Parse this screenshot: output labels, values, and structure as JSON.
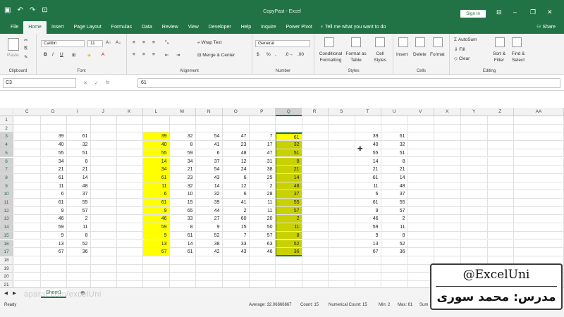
{
  "window": {
    "title": "CopyPast - Excel",
    "sign_in": "Sign in",
    "qat_icons": [
      "save-icon",
      "undo-icon",
      "redo-icon",
      "touch-mode-icon"
    ]
  },
  "tabs": [
    "File",
    "Home",
    "Insert",
    "Page Layout",
    "Formulas",
    "Data",
    "Review",
    "View",
    "Developer",
    "Help",
    "Inquire",
    "Power Pivot"
  ],
  "active_tab": "Home",
  "tell_me": "Tell me what you want to do",
  "share": "Share",
  "ribbon": {
    "clipboard": {
      "label": "Clipboard",
      "paste": "Paste"
    },
    "font": {
      "label": "Font",
      "name": "Calibri",
      "size": "11",
      "bold": "B",
      "italic": "I",
      "underline": "U"
    },
    "alignment": {
      "label": "Alignment",
      "wrap": "Wrap Text",
      "merge": "Merge & Center"
    },
    "number": {
      "label": "Number",
      "format": "General",
      "currency": "$",
      "percent": "%",
      "comma": ","
    },
    "styles": {
      "label": "Styles",
      "cond": "Conditional Formatting",
      "table": "Format as Table",
      "cell": "Cell Styles"
    },
    "cells": {
      "label": "Cells",
      "insert": "Insert",
      "delete": "Delete",
      "format": "Format"
    },
    "editing": {
      "label": "Editing",
      "autosum": "AutoSum",
      "fill": "Fill",
      "clear": "Clear",
      "sort": "Sort & Filter",
      "find": "Find & Select"
    }
  },
  "formula_bar": {
    "name_box": "C3",
    "content": "61",
    "fx": "fx"
  },
  "columns": [
    "C",
    "D",
    "I",
    "J",
    "K",
    "L",
    "M",
    "N",
    "O",
    "P",
    "Q",
    "R",
    "S",
    "T",
    "U",
    "V",
    "X",
    "Y",
    "Z",
    "AA"
  ],
  "selected_column": "Q",
  "row_numbers": [
    "1",
    "2",
    "3",
    "4",
    "5",
    "6",
    "7",
    "8",
    "9",
    "10",
    "11",
    "12",
    "13",
    "14",
    "15",
    "16",
    "17",
    "18",
    "19",
    "20",
    "21"
  ],
  "data": {
    "D": [
      "39",
      "40",
      "55",
      "34",
      "21",
      "61",
      "11",
      "6",
      "61",
      "9",
      "46",
      "59",
      "9",
      "13",
      "67"
    ],
    "I": [
      "61",
      "32",
      "51",
      "8",
      "21",
      "14",
      "48",
      "37",
      "55",
      "57",
      "2",
      "11",
      "8",
      "52",
      "36"
    ],
    "L": [
      "39",
      "40",
      "55",
      "14",
      "34",
      "61",
      "11",
      "6",
      "61",
      "9",
      "46",
      "59",
      "9",
      "13",
      "67"
    ],
    "M": [
      "32",
      "8",
      "59",
      "34",
      "21",
      "23",
      "32",
      "10",
      "15",
      "65",
      "33",
      "8",
      "61",
      "14",
      "61"
    ],
    "N": [
      "54",
      "41",
      "6",
      "37",
      "54",
      "43",
      "14",
      "32",
      "39",
      "44",
      "27",
      "9",
      "52",
      "38",
      "42"
    ],
    "O": [
      "47",
      "23",
      "48",
      "12",
      "24",
      "6",
      "12",
      "6",
      "41",
      "2",
      "60",
      "15",
      "7",
      "33",
      "43"
    ],
    "P": [
      "7",
      "17",
      "47",
      "31",
      "38",
      "25",
      "2",
      "28",
      "11",
      "11",
      "20",
      "50",
      "57",
      "63",
      "46"
    ],
    "Q": [
      "61",
      "32",
      "51",
      "8",
      "21",
      "14",
      "48",
      "37",
      "55",
      "57",
      "2",
      "11",
      "8",
      "52",
      "36"
    ],
    "T": [
      "39",
      "40",
      "55",
      "14",
      "21",
      "61",
      "11",
      "6",
      "61",
      "9",
      "46",
      "59",
      "9",
      "13",
      "67"
    ],
    "U": [
      "61",
      "32",
      "51",
      "8",
      "21",
      "14",
      "48",
      "37",
      "55",
      "57",
      "2",
      "11",
      "8",
      "52",
      "36"
    ]
  },
  "sheet_tab": "Sheet1",
  "status": {
    "ready": "Ready",
    "average": "Average: 32.06666667",
    "count": "Count: 15",
    "numerical_count": "Numerical Count: 15",
    "min": "Min: 2",
    "max": "Max: 61",
    "sum": "Sum"
  },
  "watermark": "aparat.com/excelUni",
  "badge": {
    "handle": "@ExcelUni",
    "name": "مدرس: محمد سوری"
  },
  "colors": {
    "excel_green": "#217346",
    "yellow": "#ffff00",
    "olive": "#c9d200"
  }
}
